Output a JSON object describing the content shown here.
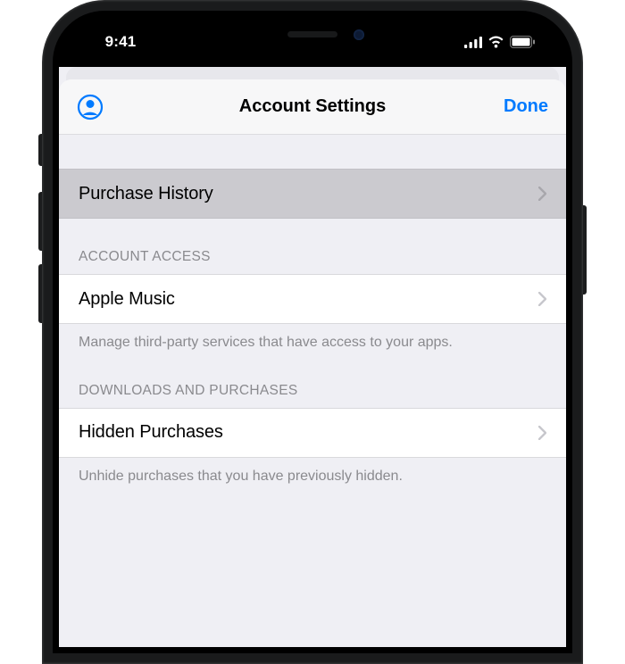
{
  "status": {
    "time": "9:41"
  },
  "nav": {
    "title": "Account Settings",
    "done": "Done"
  },
  "sections": {
    "purchase_history": {
      "label": "Purchase History"
    },
    "account_access": {
      "header": "ACCOUNT ACCESS",
      "item_label": "Apple Music",
      "footer": "Manage third-party services that have access to your apps."
    },
    "downloads": {
      "header": "DOWNLOADS AND PURCHASES",
      "item_label": "Hidden Purchases",
      "footer": "Unhide purchases that you have previously hidden."
    }
  }
}
